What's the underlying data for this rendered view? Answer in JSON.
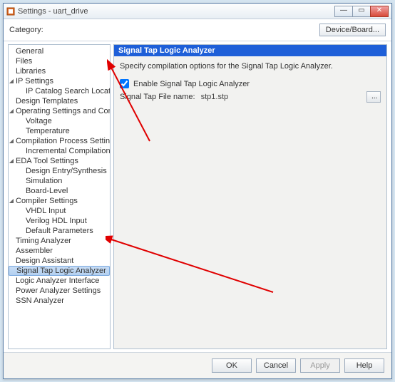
{
  "window": {
    "title": "Settings - uart_drive"
  },
  "header": {
    "category_label": "Category:",
    "device_button": "Device/Board..."
  },
  "tree": [
    {
      "label": "General",
      "level": 0
    },
    {
      "label": "Files",
      "level": 0
    },
    {
      "label": "Libraries",
      "level": 0
    },
    {
      "label": "IP Settings",
      "level": 0,
      "expanded": true
    },
    {
      "label": "IP Catalog Search Locations",
      "level": 1
    },
    {
      "label": "Design Templates",
      "level": 0
    },
    {
      "label": "Operating Settings and Conditions",
      "level": 0,
      "expanded": true
    },
    {
      "label": "Voltage",
      "level": 1
    },
    {
      "label": "Temperature",
      "level": 1
    },
    {
      "label": "Compilation Process Settings",
      "level": 0,
      "expanded": true
    },
    {
      "label": "Incremental Compilation",
      "level": 1
    },
    {
      "label": "EDA Tool Settings",
      "level": 0,
      "expanded": true
    },
    {
      "label": "Design Entry/Synthesis",
      "level": 1
    },
    {
      "label": "Simulation",
      "level": 1
    },
    {
      "label": "Board-Level",
      "level": 1
    },
    {
      "label": "Compiler Settings",
      "level": 0,
      "expanded": true
    },
    {
      "label": "VHDL Input",
      "level": 1
    },
    {
      "label": "Verilog HDL Input",
      "level": 1
    },
    {
      "label": "Default Parameters",
      "level": 1
    },
    {
      "label": "Timing Analyzer",
      "level": 0
    },
    {
      "label": "Assembler",
      "level": 0
    },
    {
      "label": "Design Assistant",
      "level": 0
    },
    {
      "label": "Signal Tap Logic Analyzer",
      "level": 0,
      "selected": true
    },
    {
      "label": "Logic Analyzer Interface",
      "level": 0
    },
    {
      "label": "Power Analyzer Settings",
      "level": 0
    },
    {
      "label": "SSN Analyzer",
      "level": 0
    }
  ],
  "panel": {
    "title": "Signal Tap Logic Analyzer",
    "description": "Specify compilation options for the Signal Tap Logic Analyzer.",
    "enable_label": "Enable Signal Tap Logic Analyzer",
    "filename_label": "Signal Tap File name:",
    "filename_value": "stp1.stp",
    "browse_label": "..."
  },
  "footer": {
    "ok": "OK",
    "cancel": "Cancel",
    "apply": "Apply",
    "help": "Help"
  }
}
